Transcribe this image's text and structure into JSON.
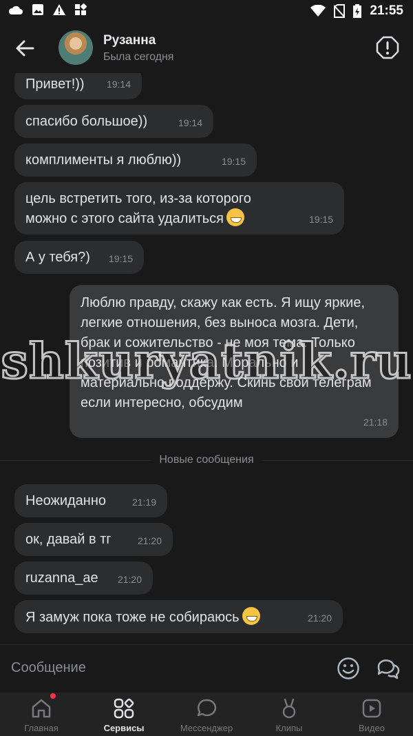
{
  "status_bar": {
    "time": "21:55"
  },
  "header": {
    "name": "Рузанна",
    "last_seen": "Была сегодня"
  },
  "messages_before": [
    {
      "text": "Привет!))",
      "time": "19:14",
      "direction": "in"
    },
    {
      "text": "спасибо большое))",
      "time": "19:14",
      "direction": "in"
    },
    {
      "text": "комплименты я люблю))",
      "time": "19:15",
      "direction": "in"
    },
    {
      "text_line1": "цель встретить того, из-за которого",
      "text_line2": "можно с этого сайта удалиться",
      "time": "19:15",
      "direction": "in"
    },
    {
      "text": "А у тебя?)",
      "time": "19:15",
      "direction": "in"
    },
    {
      "text": "Люблю правду, скажу как есть. Я ищу яркие, легкие отношения, без выноса мозга. Дети, брак и сожительство - не моя тема. Только позитив и романтика. Морально и материально поддержу. Скинь свой телеграм если интересно, обсудим",
      "time": "21:18",
      "direction": "out"
    }
  ],
  "divider_label": "Новые сообщения",
  "messages_after": [
    {
      "text": "Неожиданно",
      "time": "21:19",
      "direction": "in"
    },
    {
      "text": "ок, давай в тг",
      "time": "21:20",
      "direction": "in"
    },
    {
      "text": "ruzanna_ae",
      "time": "21:20",
      "direction": "in"
    },
    {
      "text": "Я замуж пока тоже не собираюсь",
      "time": "21:20",
      "direction": "in"
    }
  ],
  "watermark": "shkuryatnik.ru",
  "composer": {
    "placeholder": "Сообщение"
  },
  "tabs": [
    {
      "label": "Главная",
      "icon": "home-icon"
    },
    {
      "label": "Сервисы",
      "icon": "services-icon",
      "active": true
    },
    {
      "label": "Мессенджер",
      "icon": "messenger-icon"
    },
    {
      "label": "Клипы",
      "icon": "clips-icon"
    },
    {
      "label": "Видео",
      "icon": "video-icon"
    }
  ],
  "colors": {
    "background": "#19191a",
    "bubble_in": "#2c2d2e",
    "bubble_out": "#3a3b3c",
    "badge": "#ff3347"
  }
}
